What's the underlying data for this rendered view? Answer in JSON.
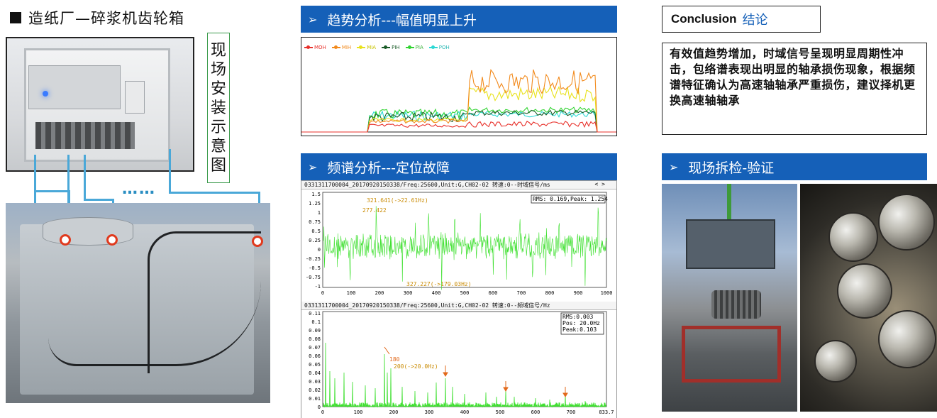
{
  "left": {
    "title": "造纸厂—碎浆机齿轮箱",
    "vertical_label": [
      "现",
      "场",
      "安",
      "装",
      "示",
      "意",
      "图"
    ],
    "dots": "……"
  },
  "trend": {
    "banner": "趋势分析---幅值明显上升",
    "arrow": "➢",
    "legend": [
      {
        "name": "MOH",
        "color": "#e8312b"
      },
      {
        "name": "MIH",
        "color": "#f28a1c"
      },
      {
        "name": "MIA",
        "color": "#e8e21c"
      },
      {
        "name": "PIH",
        "color": "#1a5c28"
      },
      {
        "name": "PIA",
        "color": "#32d432"
      },
      {
        "name": "POH",
        "color": "#2cd8d4"
      }
    ]
  },
  "spectrum": {
    "banner": "频谱分析---定位故障",
    "arrow": "➢",
    "top_header": "0331311700004_20170920150338/Freq:25600,Unit:G,CH02-02 转速:0--时域信号/ms",
    "top_nav": "< >",
    "top_info": "RMS: 0.169,Peak: 1.254",
    "top_annotations": [
      "321.641(->22.61Hz)",
      "277.422",
      "327.227(->179.03Hz)"
    ],
    "top_yticks": [
      "1.5",
      "1.25",
      "1",
      "0.75",
      "0.5",
      "0.25",
      "0",
      "-0.25",
      "-0.5",
      "-0.75",
      "-1"
    ],
    "top_xticks": [
      "0",
      "100",
      "200",
      "300",
      "400",
      "500",
      "600",
      "700",
      "800",
      "900",
      "1000"
    ],
    "bottom_header": "0331311700004_20170920150338/Freq:25600,Unit:G,CH02-02 转速:0--频域信号/Hz",
    "bottom_info": [
      "RMS:0.003",
      "Pos:   20.0Hz",
      "Peak:0.103"
    ],
    "bottom_annotations": [
      "180",
      "200(->20.0Hz)"
    ],
    "bottom_yticks": [
      "0.11",
      "0.1",
      "0.09",
      "0.08",
      "0.07",
      "0.06",
      "0.05",
      "0.04",
      "0.03",
      "0.02",
      "0.01",
      "0"
    ],
    "bottom_xticks": [
      "0",
      "100",
      "200",
      "300",
      "400",
      "500",
      "600",
      "700",
      "833.7"
    ]
  },
  "conclusion": {
    "title_en": "Conclusion",
    "title_zh": "结论",
    "body": "有效值趋势增加，时域信号呈现明显周期性冲击，包络谱表现出明显的轴承损伤现象，根据频谱特征确认为高速轴轴承严重损伤，建议择机更换高速轴轴承"
  },
  "inspection": {
    "banner": "现场拆检-验证",
    "arrow": "➢"
  }
}
